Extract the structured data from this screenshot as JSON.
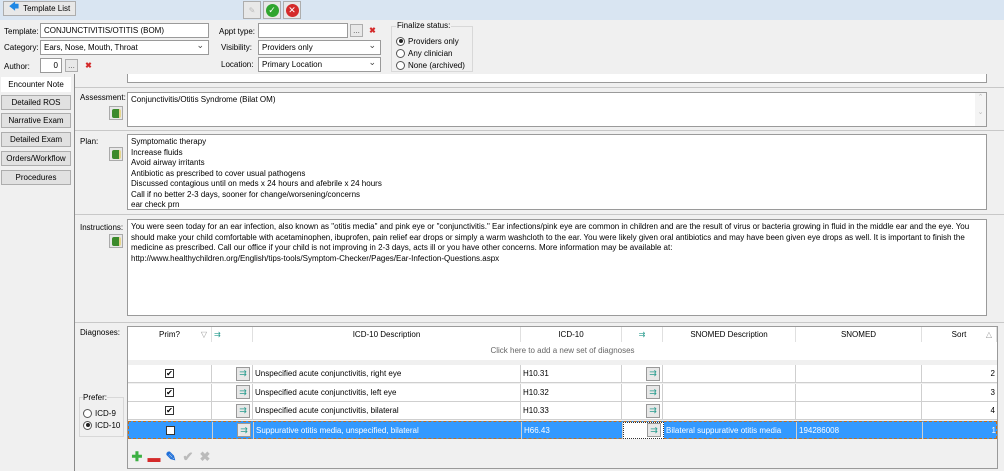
{
  "toolbar": {
    "back_label": "Template List"
  },
  "form": {
    "template_label": "Template:",
    "template_value": "CONJUNCTIVITIS/OTITIS (BOM)",
    "category_label": "Category:",
    "category_value": "Ears, Nose, Mouth, Throat",
    "author_label": "Author:",
    "author_value": "0",
    "appt_label": "Appt type:",
    "appt_value": "",
    "visibility_label": "Visibility:",
    "visibility_value": "Providers only",
    "location_label": "Location:",
    "location_value": "Primary Location",
    "browse": "...",
    "finalize": {
      "title": "Finalize status:",
      "options": [
        "Providers only",
        "Any clinician",
        "None (archived)"
      ],
      "selected": 0
    }
  },
  "tabs": [
    "Encounter Note",
    "Detailed ROS",
    "Narrative Exam",
    "Detailed Exam",
    "Orders/Workflow",
    "Procedures"
  ],
  "assessment": {
    "label": "Assessment:",
    "text": "Conjunctivitis/Otitis Syndrome (Bilat OM)"
  },
  "plan": {
    "label": "Plan:",
    "text": "Symptomatic therapy\nIncrease fluids\nAvoid airway irritants\nAntibiotic as prescribed to cover usual pathogens\nDiscussed contagious until on meds x 24 hours and afebrile x 24 hours\nCall if no better 2-3 days, sooner for change/worsening/concerns\near check prn"
  },
  "instructions": {
    "label": "Instructions:",
    "text": "You were seen today for an ear infection, also known as \"otitis media\" and pink eye or \"conjunctivitis.\" Ear infections/pink eye are common in children and are the result of virus or bacteria growing in fluid in the middle ear and the eye. You should make your child comfortable with acetaminophen, ibuprofen, pain relief ear drops or simply a warm washcloth to the ear. You were likely given oral antibiotics and may have been given eye drops as well. It is important to finish the medicine as prescribed. Call our office if your child is not improving in 2-3 days, acts ill or you have other concerns. More information may be available at:\nhttp://www.healthychildren.org/English/tips-tools/Symptom-Checker/Pages/Ear-Infection-Questions.aspx"
  },
  "diagnoses": {
    "label": "Diagnoses:",
    "prefer": {
      "title": "Prefer:",
      "options": [
        "ICD-9",
        "ICD-10"
      ],
      "selected": 1
    },
    "headers": [
      "Prim?",
      "ICD-10 Description",
      "ICD-10",
      "SNOMED Description",
      "SNOMED",
      "Sort"
    ],
    "add_row": "Click here to add a new set of diagnoses",
    "rows": [
      {
        "prim": true,
        "desc": "Unspecified acute conjunctivitis, right eye",
        "icd10": "H10.31",
        "snomed_desc": "",
        "snomed": "",
        "sort": "2"
      },
      {
        "prim": true,
        "desc": "Unspecified acute conjunctivitis, left eye",
        "icd10": "H10.32",
        "snomed_desc": "",
        "snomed": "",
        "sort": "3"
      },
      {
        "prim": true,
        "desc": "Unspecified acute conjunctivitis, bilateral",
        "icd10": "H10.33",
        "snomed_desc": "",
        "snomed": "",
        "sort": "4"
      },
      {
        "prim": false,
        "desc": "Suppurative otitis media, unspecified, bilateral",
        "icd10": "H66.43",
        "snomed_desc": "Bilateral suppurative otitis media",
        "snomed": "194286008",
        "sort": "1"
      }
    ]
  },
  "colors": {
    "selection": "#3399ff",
    "topbar": "#d9e5f2"
  }
}
